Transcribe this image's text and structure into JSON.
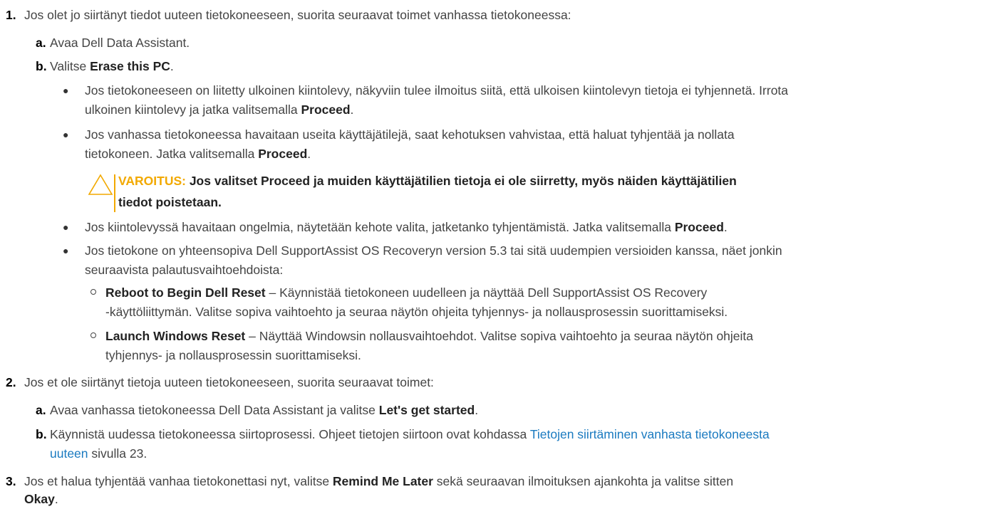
{
  "steps": [
    {
      "number": "1.",
      "text": "Jos olet jo siirtänyt tiedot uuteen tietokoneeseen, suorita seuraavat toimet vanhassa tietokoneessa:",
      "substeps": [
        {
          "letter": "a.",
          "text": "Avaa Dell Data Assistant."
        },
        {
          "letter": "b.",
          "text_before": "Valitse ",
          "bold": "Erase this PC",
          "text_after": "."
        }
      ],
      "bullets": [
        {
          "line1": "Jos tietokoneeseen on liitetty ulkoinen kiintolevy, näkyviin tulee ilmoitus siitä, että ulkoisen kiintolevyn tietoja ei tyhjennetä. Irrota",
          "line2_before": "ulkoinen kiintolevy ja jatka valitsemalla ",
          "line2_bold": "Proceed",
          "line2_after": "."
        },
        {
          "line1": "Jos vanhassa tietokoneessa havaitaan useita käyttäjätilejä, saat kehotuksen vahvistaa, että haluat tyhjentää ja nollata",
          "line2_before": "tietokoneen. Jatka valitsemalla ",
          "line2_bold": "Proceed",
          "line2_after": "."
        },
        {
          "line1_before": "Jos kiintolevyssä havaitaan ongelmia, näytetään kehote valita, jatketanko tyhjentämistä. Jatka valitsemalla ",
          "line1_bold": "Proceed",
          "line1_after": "."
        },
        {
          "line1": "Jos tietokone on yhteensopiva Dell SupportAssist OS Recoveryn version 5.3 tai sitä uudempien versioiden kanssa, näet jonkin",
          "line2": "seuraavista palautusvaihtoehdoista:"
        }
      ],
      "warning": {
        "label": "VAROITUS:",
        "line1": " Jos valitset Proceed ja muiden käyttäjätilien tietoja ei ole siirretty, myös näiden käyttäjätilien",
        "line2": "tiedot poistetaan."
      },
      "options": [
        {
          "bold": "Reboot to Begin Dell Reset",
          "line1_after": " – Käynnistää tietokoneen uudelleen ja näyttää Dell SupportAssist OS Recovery",
          "line2": "-käyttöliittymän. Valitse sopiva vaihtoehto ja seuraa näytön ohjeita tyhjennys- ja nollausprosessin suorittamiseksi."
        },
        {
          "bold": "Launch Windows Reset",
          "line1_after": " – Näyttää Windowsin nollausvaihtoehdot. Valitse sopiva vaihtoehto ja seuraa näytön ohjeita",
          "line2": "tyhjennys- ja nollausprosessin suorittamiseksi."
        }
      ]
    },
    {
      "number": "2.",
      "text": "Jos et ole siirtänyt tietoja uuteen tietokoneeseen, suorita seuraavat toimet:",
      "substeps": [
        {
          "letter": "a.",
          "text_before": "Avaa vanhassa tietokoneessa Dell Data Assistant ja valitse ",
          "bold": "Let's get started",
          "text_after": "."
        },
        {
          "letter": "b.",
          "text_before": "Käynnistä uudessa tietokoneessa siirtoprosessi. Ohjeet tietojen siirtoon ovat kohdassa ",
          "link_line1": "Tietojen siirtäminen vanhasta tietokoneesta",
          "link_line2": "uuteen",
          "text_after": " sivulla 23."
        }
      ]
    },
    {
      "number": "3.",
      "text_before": "Jos et halua tyhjentää vanhaa tietokonettasi nyt, valitse ",
      "bold1": "Remind Me Later",
      "text_middle": " sekä seuraavan ilmoituksen ajankohta ja valitse sitten",
      "bold2": "Okay",
      "text_after": "."
    }
  ],
  "colors": {
    "warning": "#f2a900",
    "link": "#1a7ac0"
  }
}
